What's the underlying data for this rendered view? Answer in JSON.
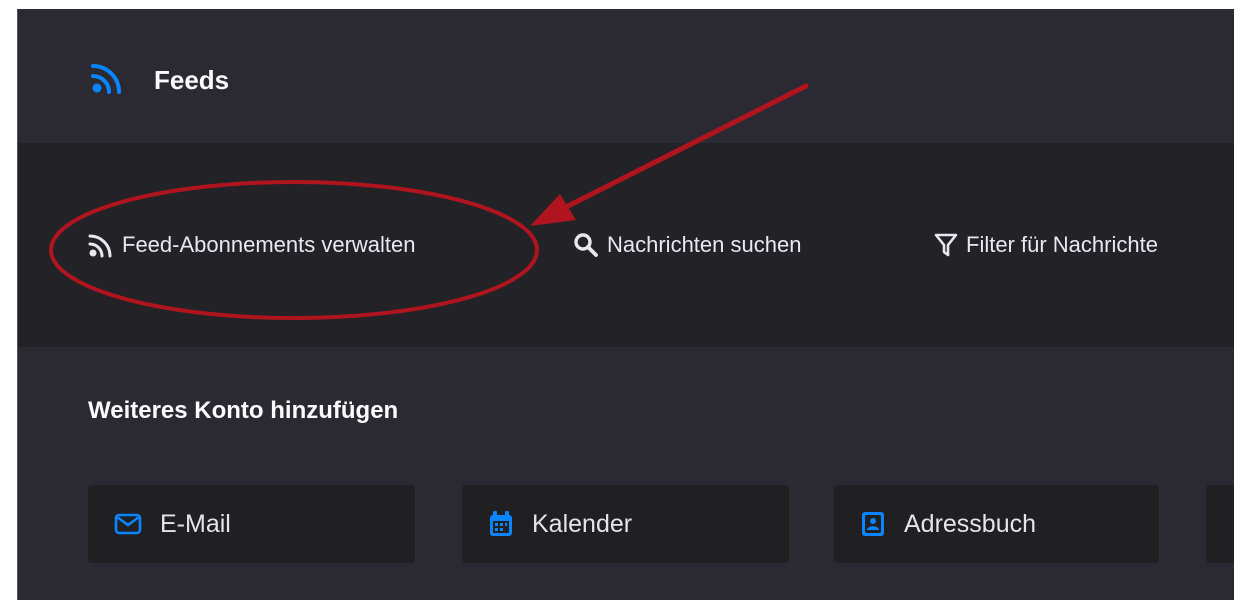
{
  "header": {
    "title": "Feeds",
    "icon": "rss-icon"
  },
  "toolbar": {
    "items": [
      {
        "label": "Feed-Abonnements verwalten",
        "icon": "rss-icon"
      },
      {
        "label": "Nachrichten suchen",
        "icon": "search-icon"
      },
      {
        "label": "Filter für Nachrichte",
        "icon": "filter-icon"
      }
    ]
  },
  "section": {
    "title": "Weiteres Konto hinzufügen"
  },
  "tiles": [
    {
      "label": "E-Mail",
      "icon": "mail-icon"
    },
    {
      "label": "Kalender",
      "icon": "calendar-icon"
    },
    {
      "label": "Adressbuch",
      "icon": "address-book-icon"
    }
  ],
  "colors": {
    "accent": "#0a84ff",
    "background": "#2b2a33",
    "toolbar": "#232227",
    "annotation": "#b0141e"
  }
}
